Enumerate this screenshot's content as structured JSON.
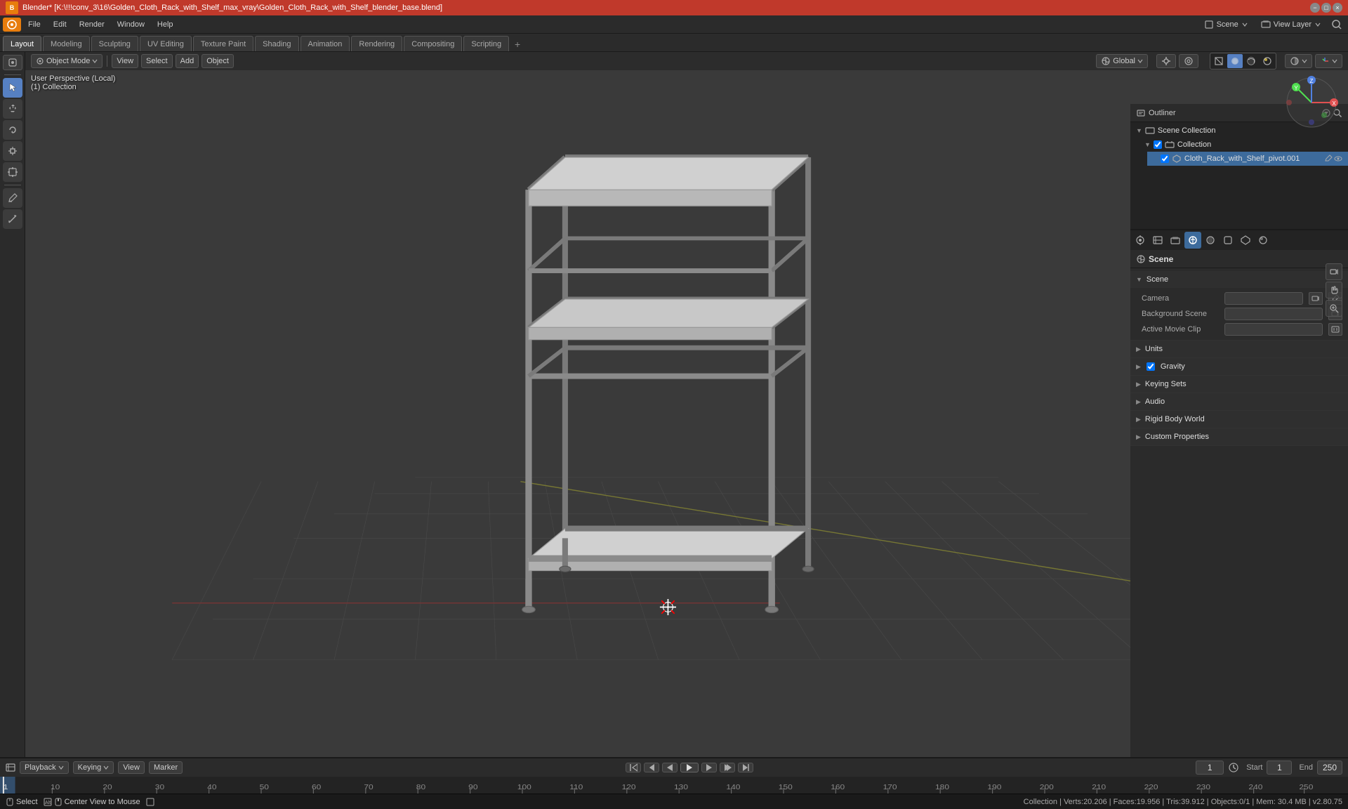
{
  "titlebar": {
    "title": "Blender* [K:\\!!!conv_3\\16\\Golden_Cloth_Rack_with_Shelf_max_vray\\Golden_Cloth_Rack_with_Shelf_blender_base.blend]"
  },
  "menubar": {
    "items": [
      "Blender",
      "File",
      "Edit",
      "Render",
      "Window",
      "Help"
    ]
  },
  "workspace_tabs": {
    "tabs": [
      "Layout",
      "Modeling",
      "Sculpting",
      "UV Editing",
      "Texture Paint",
      "Shading",
      "Animation",
      "Rendering",
      "Compositing",
      "Scripting"
    ],
    "active": "Layout",
    "scene_label": "Scene",
    "view_layer_label": "View Layer"
  },
  "viewport": {
    "mode": "Object Mode",
    "view_label": "View",
    "select_label": "Select",
    "add_label": "Add",
    "object_label": "Object",
    "perspective": "User Perspective (Local)",
    "collection": "(1) Collection",
    "transform_global": "Global",
    "header_icons": [
      "grid",
      "dot-circle",
      "sphere",
      "shading",
      "overlay",
      "gizmo"
    ]
  },
  "nav_gizmo": {
    "x_label": "X",
    "y_label": "Y",
    "z_label": "Z"
  },
  "outliner": {
    "title": "Outliner",
    "items": [
      {
        "label": "Scene Collection",
        "level": 0,
        "icon": "scene",
        "expanded": true
      },
      {
        "label": "Collection",
        "level": 1,
        "icon": "collection",
        "expanded": true,
        "checked": true
      },
      {
        "label": "Cloth_Rack_with_Shelf_pivot.001",
        "level": 2,
        "icon": "object",
        "checked": true
      }
    ]
  },
  "properties": {
    "title": "Scene",
    "panel_label": "Scene",
    "tabs": [
      {
        "icon": "render",
        "label": "render-tab"
      },
      {
        "icon": "output",
        "label": "output-tab"
      },
      {
        "icon": "view-layer",
        "label": "view-layer-tab"
      },
      {
        "icon": "scene",
        "label": "scene-tab",
        "active": true
      },
      {
        "icon": "world",
        "label": "world-tab"
      },
      {
        "icon": "object",
        "label": "object-tab"
      },
      {
        "icon": "mesh",
        "label": "mesh-tab"
      },
      {
        "icon": "material",
        "label": "material-tab"
      },
      {
        "icon": "particles",
        "label": "particles-tab"
      },
      {
        "icon": "physics",
        "label": "physics-tab"
      },
      {
        "icon": "constraints",
        "label": "constraints-tab"
      },
      {
        "icon": "modifiers",
        "label": "modifiers-tab"
      }
    ],
    "sections": [
      {
        "label": "Scene",
        "expanded": true,
        "rows": [
          {
            "label": "Camera",
            "value": "",
            "has_icon": true
          },
          {
            "label": "Background Scene",
            "value": "",
            "has_icon": true
          },
          {
            "label": "Active Movie Clip",
            "value": "",
            "has_icon": true
          }
        ]
      },
      {
        "label": "Units",
        "expanded": false,
        "rows": []
      },
      {
        "label": "Gravity",
        "expanded": false,
        "checked": true,
        "rows": []
      },
      {
        "label": "Keying Sets",
        "expanded": false,
        "rows": []
      },
      {
        "label": "Audio",
        "expanded": false,
        "rows": []
      },
      {
        "label": "Rigid Body World",
        "expanded": false,
        "rows": []
      },
      {
        "label": "Custom Properties",
        "expanded": false,
        "rows": []
      }
    ]
  },
  "timeline": {
    "playback_label": "Playback",
    "keying_label": "Keying",
    "view_label": "View",
    "marker_label": "Marker",
    "current_frame": "1",
    "start_label": "Start",
    "start_value": "1",
    "end_label": "End",
    "end_value": "250",
    "ruler_marks": [
      "1",
      "10",
      "20",
      "30",
      "40",
      "50",
      "60",
      "70",
      "80",
      "90",
      "100",
      "110",
      "120",
      "130",
      "140",
      "150",
      "160",
      "170",
      "180",
      "190",
      "200",
      "210",
      "220",
      "230",
      "240",
      "250"
    ]
  },
  "statusbar": {
    "select_label": "Select",
    "center_view_label": "Center View to Mouse",
    "stats": "Collection | Verts:20.206 | Faces:19.956 | Tris:39.912 | Objects:0/1 | Mem: 30.4 MB | v2.80.75"
  }
}
